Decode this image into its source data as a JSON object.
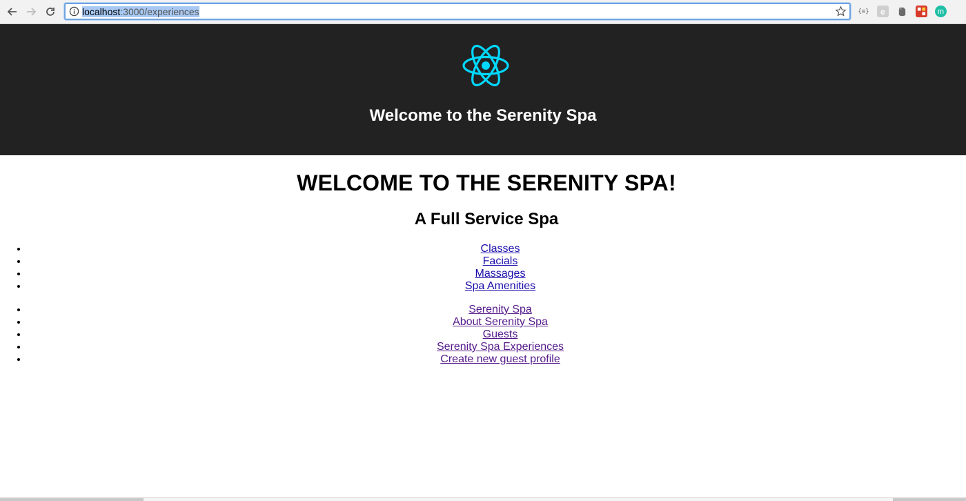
{
  "browser": {
    "url_host": "localhost",
    "url_rest": ":3000/experiences",
    "extensions": [
      "json-viewer-icon",
      "e-extension-icon",
      "evernote-icon",
      "puzzle-extension-icon",
      "profile-m-icon"
    ],
    "profile_letter": "m",
    "json_ext_label": "{≡}",
    "e_ext_label": "e"
  },
  "header": {
    "title": "Welcome to the Serenity Spa",
    "logo_color": "#00d8ff",
    "background": "#222222"
  },
  "main": {
    "heading": "WELCOME TO THE SERENITY SPA!",
    "subheading": "A Full Service Spa",
    "services": [
      {
        "label": "Classes"
      },
      {
        "label": "Facials"
      },
      {
        "label": "Massages"
      },
      {
        "label": "Spa Amenities"
      }
    ],
    "nav": [
      {
        "label": "Serenity Spa"
      },
      {
        "label": "About Serenity Spa"
      },
      {
        "label": "Guests"
      },
      {
        "label": "Serenity Spa Experiences"
      },
      {
        "label": "Create new guest profile"
      }
    ]
  }
}
